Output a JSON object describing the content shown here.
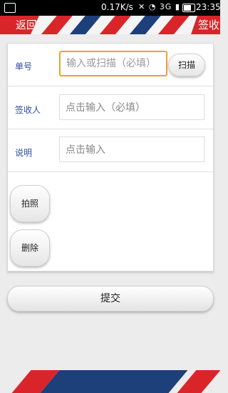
{
  "status_bar": {
    "speed": "0.17K/s",
    "time": "23:35",
    "signal": "3G"
  },
  "header": {
    "back_label": "返回",
    "sign_label": "签收",
    "colors": {
      "red": "#d9252a",
      "navy": "#1d3f7a"
    }
  },
  "form": {
    "tracking": {
      "label": "单号",
      "placeholder": "输入或扫描（必填）",
      "scan_label": "扫描"
    },
    "recipient": {
      "label": "签收人",
      "placeholder": "点击输入（必填）"
    },
    "note": {
      "label": "说明",
      "placeholder": "点击输入"
    },
    "photo_label": "拍照",
    "delete_label": "删除"
  },
  "submit_label": "提交"
}
